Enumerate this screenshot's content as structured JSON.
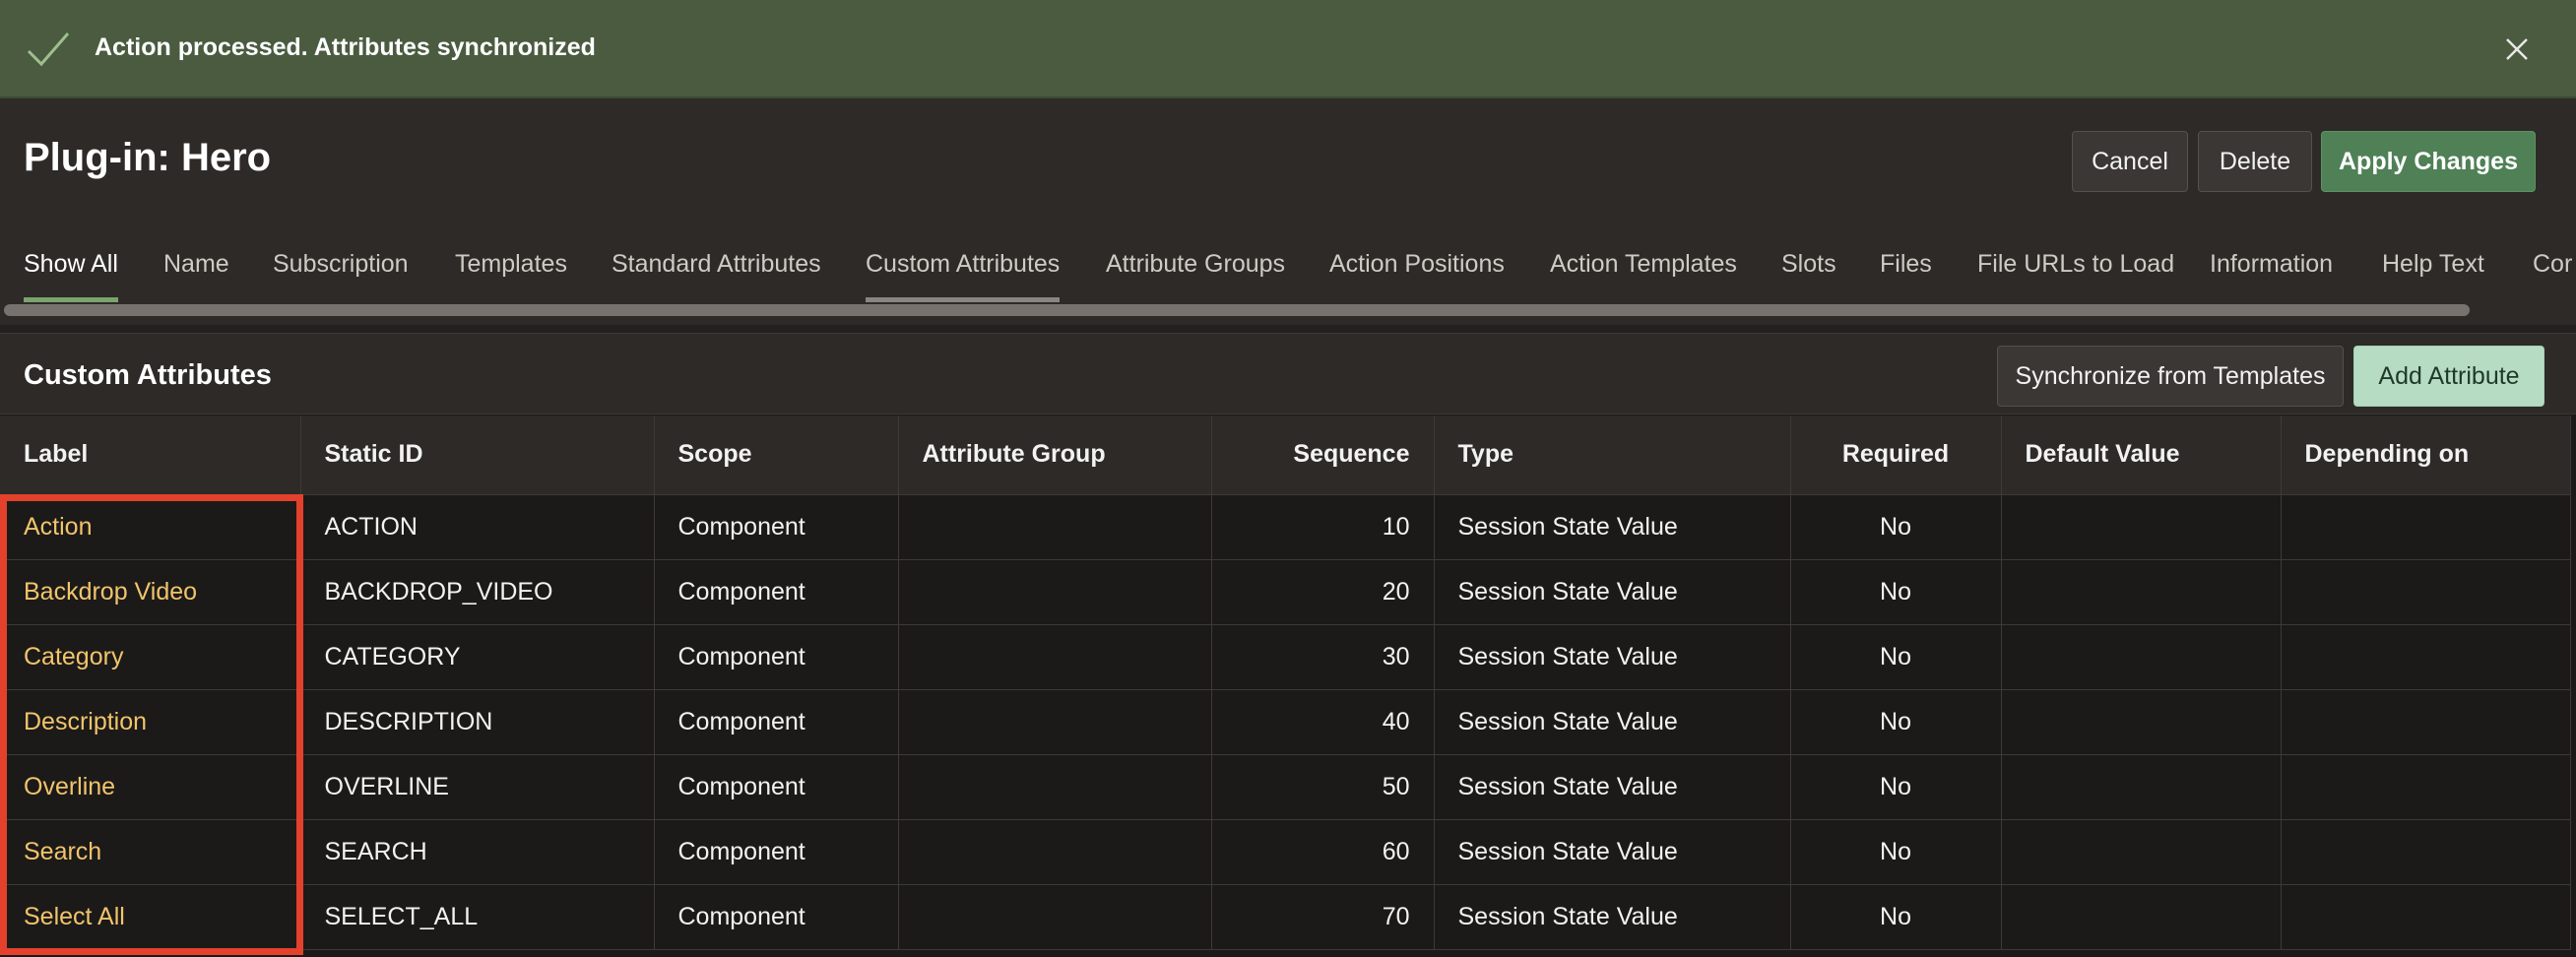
{
  "banner": {
    "message": "Action processed. Attributes synchronized",
    "color": "#4a5b40"
  },
  "page": {
    "title": "Plug-in: Hero"
  },
  "actions": {
    "cancel": "Cancel",
    "delete": "Delete",
    "apply": "Apply Changes"
  },
  "tabs": [
    "Show All",
    "Name",
    "Subscription",
    "Templates",
    "Standard Attributes",
    "Custom Attributes",
    "Attribute Groups",
    "Action Positions",
    "Action Templates",
    "Slots",
    "Files",
    "File URLs to Load",
    "Information",
    "Help Text",
    "Cor"
  ],
  "region": {
    "title": "Custom Attributes",
    "sync_button": "Synchronize from Templates",
    "add_button": "Add Attribute"
  },
  "table": {
    "headers": [
      "Label",
      "Static ID",
      "Scope",
      "Attribute Group",
      "Sequence",
      "Type",
      "Required",
      "Default Value",
      "Depending on"
    ],
    "rows": [
      {
        "label": "Action",
        "static_id": "ACTION",
        "scope": "Component",
        "group": "",
        "sequence": "10",
        "type": "Session State Value",
        "required": "No",
        "default": "",
        "depending": ""
      },
      {
        "label": "Backdrop Video",
        "static_id": "BACKDROP_VIDEO",
        "scope": "Component",
        "group": "",
        "sequence": "20",
        "type": "Session State Value",
        "required": "No",
        "default": "",
        "depending": ""
      },
      {
        "label": "Category",
        "static_id": "CATEGORY",
        "scope": "Component",
        "group": "",
        "sequence": "30",
        "type": "Session State Value",
        "required": "No",
        "default": "",
        "depending": ""
      },
      {
        "label": "Description",
        "static_id": "DESCRIPTION",
        "scope": "Component",
        "group": "",
        "sequence": "40",
        "type": "Session State Value",
        "required": "No",
        "default": "",
        "depending": ""
      },
      {
        "label": "Overline",
        "static_id": "OVERLINE",
        "scope": "Component",
        "group": "",
        "sequence": "50",
        "type": "Session State Value",
        "required": "No",
        "default": "",
        "depending": ""
      },
      {
        "label": "Search",
        "static_id": "SEARCH",
        "scope": "Component",
        "group": "",
        "sequence": "60",
        "type": "Session State Value",
        "required": "No",
        "default": "",
        "depending": ""
      },
      {
        "label": "Select All",
        "static_id": "SELECT_ALL",
        "scope": "Component",
        "group": "",
        "sequence": "70",
        "type": "Session State Value",
        "required": "No",
        "default": "",
        "depending": ""
      }
    ]
  },
  "colors": {
    "accent": "#4f8056",
    "link": "#f2c46b",
    "highlight": "#e3412c"
  }
}
